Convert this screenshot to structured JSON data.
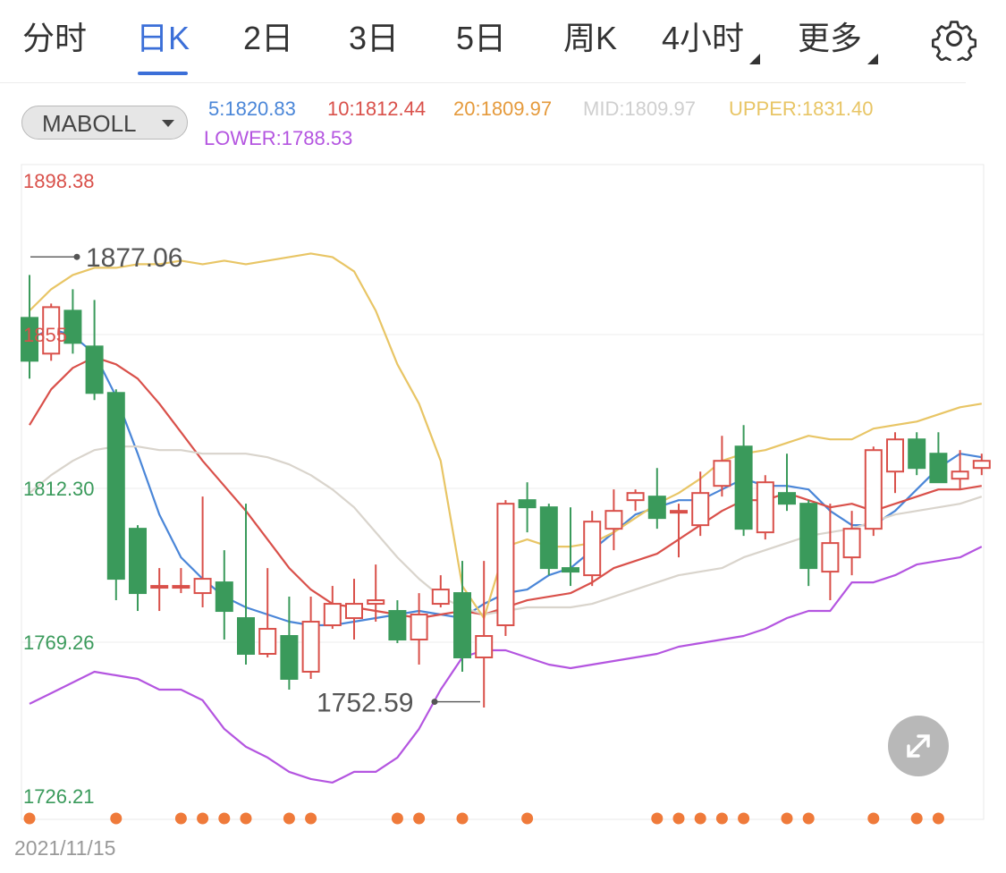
{
  "tabs": [
    {
      "label": "分时",
      "active": false,
      "dropdown": false
    },
    {
      "label": "日K",
      "active": true,
      "dropdown": false
    },
    {
      "label": "2日",
      "active": false,
      "dropdown": false
    },
    {
      "label": "3日",
      "active": false,
      "dropdown": false
    },
    {
      "label": "5日",
      "active": false,
      "dropdown": false
    },
    {
      "label": "周K",
      "active": false,
      "dropdown": false
    },
    {
      "label": "4小时",
      "active": false,
      "dropdown": true
    },
    {
      "label": "更多",
      "active": false,
      "dropdown": true
    }
  ],
  "settings_icon": "gear-icon",
  "indicator": {
    "selected": "MABOLL",
    "legend": [
      {
        "text": "5:1820.83",
        "color": "#4a86d8"
      },
      {
        "text": "10:1812.44",
        "color": "#d9504a"
      },
      {
        "text": "20:1809.97",
        "color": "#e59a3c"
      },
      {
        "text": "MID:1809.97",
        "color": "#cfcfcf"
      },
      {
        "text": "UPPER:1831.40",
        "color": "#e8c565"
      },
      {
        "text": "LOWER:1788.53",
        "color": "#b455e0"
      }
    ]
  },
  "chart_data": {
    "type": "candlestick",
    "y_axis_labels": [
      {
        "text": "1898.38",
        "value": 1898.38,
        "color": "#d9504a"
      },
      {
        "text": "1855",
        "value": 1855.34,
        "color": "#d9504a"
      },
      {
        "text": "1812.30",
        "value": 1812.3,
        "color": "#3a9a5b"
      },
      {
        "text": "1769.26",
        "value": 1769.26,
        "color": "#3a9a5b"
      },
      {
        "text": "1726.21",
        "value": 1726.21,
        "color": "#3a9a5b"
      }
    ],
    "ylim": [
      1726.21,
      1898.38
    ],
    "grid": true,
    "high_marker": {
      "text": "1877.06",
      "value": 1877.06
    },
    "low_marker": {
      "text": "1752.59",
      "value": 1752.59
    },
    "up_color": "#d9504a",
    "down_color": "#3a9a5b",
    "candles": [
      [
        1860,
        1848,
        1872,
        1843
      ],
      [
        1850,
        1863,
        1864,
        1848
      ],
      [
        1862,
        1853,
        1868,
        1850
      ],
      [
        1852,
        1839,
        1865,
        1837
      ],
      [
        1839,
        1787,
        1840,
        1781
      ],
      [
        1801,
        1783,
        1802,
        1778
      ],
      [
        1785,
        1785,
        1790,
        1778
      ],
      [
        1785,
        1785,
        1790,
        1783
      ],
      [
        1783,
        1787,
        1810,
        1779
      ],
      [
        1786,
        1778,
        1795,
        1770
      ],
      [
        1776,
        1766,
        1808,
        1763
      ],
      [
        1766,
        1773,
        1790,
        1765
      ],
      [
        1771,
        1759,
        1782,
        1756
      ],
      [
        1761,
        1775,
        1782,
        1759
      ],
      [
        1774,
        1780,
        1785,
        1773
      ],
      [
        1776,
        1780,
        1787,
        1770
      ],
      [
        1780,
        1781,
        1791,
        1775
      ],
      [
        1778,
        1770,
        1781,
        1769
      ],
      [
        1770,
        1777,
        1783,
        1763
      ],
      [
        1780,
        1784,
        1788,
        1779
      ],
      [
        1783,
        1765,
        1792,
        1761
      ],
      [
        1765,
        1771,
        1792,
        1751
      ],
      [
        1774,
        1808,
        1809,
        1771
      ],
      [
        1809,
        1807,
        1814,
        1800
      ],
      [
        1807,
        1790,
        1808,
        1788
      ],
      [
        1790,
        1789,
        1807,
        1785
      ],
      [
        1788,
        1803,
        1806,
        1785
      ],
      [
        1801,
        1806,
        1812,
        1795
      ],
      [
        1809,
        1811,
        1812,
        1806
      ],
      [
        1810,
        1804,
        1818,
        1801
      ],
      [
        1806,
        1806,
        1808,
        1793
      ],
      [
        1802,
        1811,
        1817,
        1799
      ],
      [
        1813,
        1820,
        1827,
        1810
      ],
      [
        1824,
        1801,
        1830,
        1799
      ],
      [
        1800,
        1814,
        1816,
        1798
      ],
      [
        1811,
        1808,
        1822,
        1806
      ],
      [
        1808,
        1790,
        1809,
        1785
      ],
      [
        1789,
        1797,
        1808,
        1781
      ],
      [
        1793,
        1801,
        1806,
        1788
      ],
      [
        1801,
        1823,
        1824,
        1799
      ],
      [
        1817,
        1826,
        1828,
        1811
      ],
      [
        1826,
        1818,
        1828,
        1816
      ],
      [
        1822,
        1814,
        1828,
        1815
      ],
      [
        1815,
        1817,
        1823,
        1812
      ],
      [
        1818,
        1820,
        1822,
        1816
      ]
    ],
    "series": [
      {
        "name": "5",
        "color": "#4a86d8",
        "values": [
          1854,
          1857,
          1855,
          1850,
          1838,
          1822,
          1805,
          1793,
          1787,
          1782,
          1779,
          1777,
          1775,
          1774,
          1774,
          1775,
          1776,
          1777,
          1778,
          1777,
          1776,
          1780,
          1783,
          1784,
          1788,
          1790,
          1795,
          1800,
          1805,
          1807,
          1809,
          1809,
          1812,
          1815,
          1813,
          1813,
          1812,
          1806,
          1802,
          1802,
          1806,
          1812,
          1818,
          1822,
          1821
        ]
      },
      {
        "name": "10",
        "color": "#d9504a",
        "values": [
          1830,
          1840,
          1846,
          1849,
          1847,
          1843,
          1836,
          1828,
          1820,
          1813,
          1806,
          1798,
          1790,
          1784,
          1780,
          1779,
          1778,
          1777,
          1776,
          1777,
          1778,
          1777,
          1779,
          1781,
          1782,
          1783,
          1786,
          1790,
          1792,
          1794,
          1798,
          1802,
          1806,
          1809,
          1809,
          1811,
          1809,
          1807,
          1808,
          1806,
          1808,
          1810,
          1812,
          1812,
          1813
        ]
      },
      {
        "name": "MID",
        "color": "#d9d4cc",
        "values": [
          1811,
          1816,
          1820,
          1823,
          1824,
          1824,
          1823,
          1823,
          1822,
          1822,
          1822,
          1821,
          1819,
          1816,
          1812,
          1807,
          1800,
          1793,
          1787,
          1782,
          1779,
          1777,
          1778,
          1779,
          1779,
          1779,
          1780,
          1782,
          1784,
          1786,
          1788,
          1789,
          1790,
          1793,
          1795,
          1797,
          1799,
          1800,
          1801,
          1803,
          1805,
          1806,
          1807,
          1808,
          1810
        ]
      },
      {
        "name": "UPPER",
        "color": "#e8c565",
        "values": [
          1862,
          1868,
          1872,
          1874,
          1874,
          1875,
          1875,
          1876,
          1875,
          1876,
          1875,
          1876,
          1877,
          1878,
          1877,
          1873,
          1862,
          1847,
          1836,
          1820,
          1785,
          1776,
          1796,
          1798,
          1796,
          1796,
          1797,
          1800,
          1804,
          1808,
          1811,
          1815,
          1820,
          1822,
          1823,
          1825,
          1827,
          1826,
          1826,
          1829,
          1830,
          1831,
          1833,
          1835,
          1836
        ]
      },
      {
        "name": "LOWER",
        "color": "#b455e0",
        "values": [
          1752,
          1755,
          1758,
          1761,
          1760,
          1759,
          1756,
          1756,
          1753,
          1745,
          1740,
          1737,
          1733,
          1731,
          1730,
          1733,
          1733,
          1737,
          1745,
          1756,
          1765,
          1767,
          1767,
          1765,
          1763,
          1762,
          1763,
          1764,
          1765,
          1766,
          1768,
          1769,
          1770,
          1771,
          1773,
          1776,
          1778,
          1778,
          1786,
          1786,
          1788,
          1791,
          1792,
          1793,
          1796
        ]
      }
    ],
    "signal_dots": [
      0,
      4,
      7,
      8,
      9,
      10,
      12,
      13,
      17,
      18,
      20,
      23,
      29,
      30,
      31,
      32,
      33,
      35,
      36,
      39,
      41,
      42
    ],
    "signal_color": "#ef7a3a",
    "x_start_label": "2021/11/15"
  }
}
